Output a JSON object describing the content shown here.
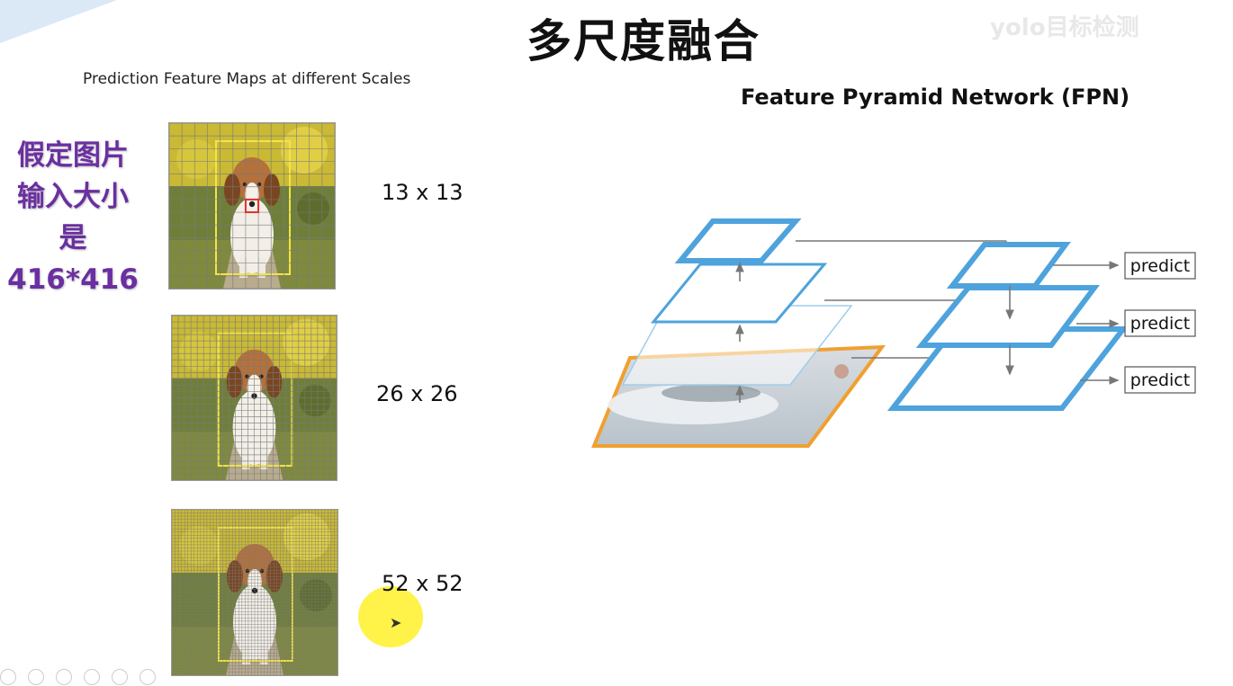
{
  "header": {
    "title": "多尺度融合",
    "watermark": "yolo目标检测"
  },
  "left_panel": {
    "caption": "Prediction Feature Maps at different Scales",
    "side_note_lines": [
      "假定图片",
      "输入大小",
      "是",
      "416*416"
    ],
    "scales": [
      {
        "label": "13 x 13",
        "grid": 13
      },
      {
        "label": "26 x 26",
        "grid": 26
      },
      {
        "label": "52 x 52",
        "grid": 52
      }
    ]
  },
  "fpn": {
    "title": "Feature Pyramid Network (FPN)",
    "outputs": [
      "predict",
      "predict",
      "predict"
    ]
  },
  "colors": {
    "pyramid_blue": "#4ea3dc",
    "image_border_orange": "#f0a030",
    "side_note_purple": "#6a2fa0",
    "grid_line": "#7a7a7a",
    "bbox_yellow": "#f2e44a"
  }
}
